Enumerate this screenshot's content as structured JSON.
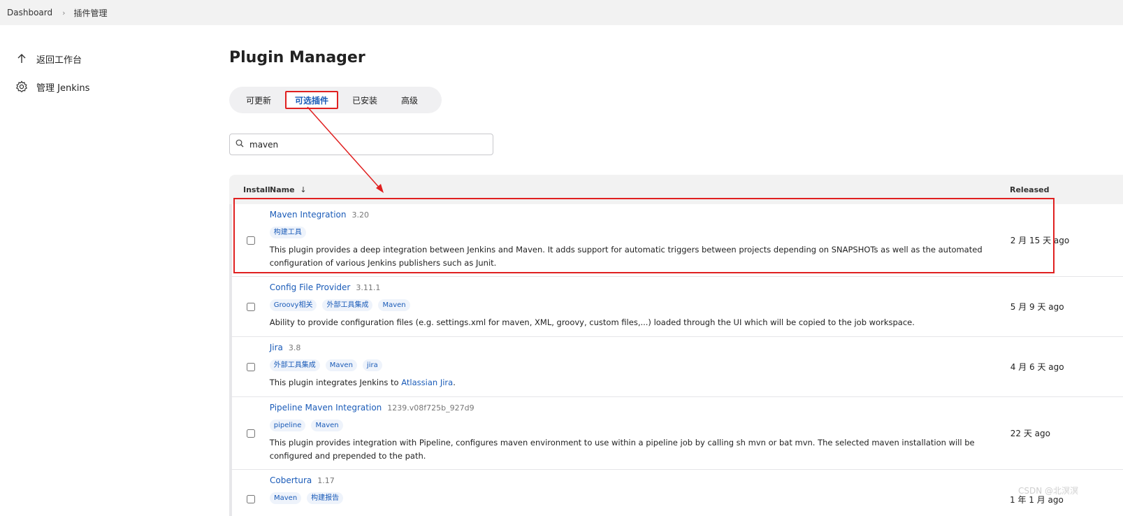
{
  "breadcrumb": {
    "items": [
      "Dashboard",
      "插件管理"
    ]
  },
  "sidebar": {
    "items": [
      {
        "label": "返回工作台",
        "icon": "arrow-up-icon"
      },
      {
        "label": "管理 Jenkins",
        "icon": "gear-icon"
      }
    ]
  },
  "page": {
    "title": "Plugin Manager"
  },
  "tabs": [
    {
      "label": "可更新"
    },
    {
      "label": "可选插件",
      "active": true
    },
    {
      "label": "已安装"
    },
    {
      "label": "高级"
    }
  ],
  "search": {
    "value": "maven"
  },
  "table": {
    "headers": {
      "install": "Install",
      "name": "Name",
      "sort": "↓",
      "released": "Released"
    },
    "rows": [
      {
        "name": "Maven Integration",
        "version": "3.20",
        "tags": [
          "构建工具"
        ],
        "desc": "This plugin provides a deep integration between Jenkins and Maven. It adds support for automatic triggers between projects depending on SNAPSHOTs as well as the automated configuration of various Jenkins publishers such as Junit.",
        "released": "2 月 15 天 ago"
      },
      {
        "name": "Config File Provider",
        "version": "3.11.1",
        "tags": [
          "Groovy相关",
          "外部工具集成",
          "Maven"
        ],
        "desc": "Ability to provide configuration files (e.g. settings.xml for maven, XML, groovy, custom files,...) loaded through the UI which will be copied to the job workspace.",
        "released": "5 月 9 天 ago"
      },
      {
        "name": "Jira",
        "version": "3.8",
        "tags": [
          "外部工具集成",
          "Maven",
          "jira"
        ],
        "desc_prefix": "This plugin integrates Jenkins to ",
        "desc_link": "Atlassian Jira",
        "desc_suffix": ".",
        "released": "4 月 6 天 ago"
      },
      {
        "name": "Pipeline Maven Integration",
        "version": "1239.v08f725b_927d9",
        "tags": [
          "pipeline",
          "Maven"
        ],
        "desc": "This plugin provides integration with Pipeline, configures maven environment to use within a pipeline job by calling sh mvn or bat mvn. The selected maven installation will be configured and prepended to the path.",
        "released": "22 天 ago"
      },
      {
        "name": "Cobertura",
        "version": "1.17",
        "tags": [
          "Maven",
          "构建报告"
        ],
        "desc": "",
        "released": "1 年 1 月 ago"
      }
    ]
  },
  "watermark": "CSDN @北溟溟",
  "colors": {
    "accent": "#1a5bb8",
    "annotation": "#e02020"
  }
}
